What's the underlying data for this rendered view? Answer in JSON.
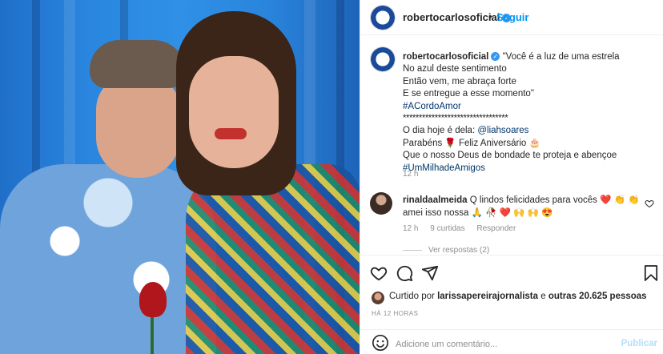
{
  "post": {
    "username": "robertocarlosoficial",
    "follow_label": "Seguir",
    "separator": "•"
  },
  "caption": {
    "username": "robertocarlosoficial",
    "lines": [
      "\"Você é a luz de uma estrela",
      "No azul deste sentimento",
      "Então vem, me abraça forte",
      "E se entregue a esse momento\""
    ],
    "hashtag1": "#ACordoAmor",
    "divider": "*********************************",
    "day_prefix": "O dia hoje é dela: ",
    "mention": "@liahsoares",
    "birthday": "Parabéns 🌹 Feliz Aniversário 🎂",
    "blessing": "Que o nosso Deus de bondade te proteja e abençoe",
    "hashtag2": "#UmMilhadeAmigos",
    "time": "12 h"
  },
  "comment": {
    "username": "rinaldaalmeida",
    "text": "Q lindos felicidades para vocês ❤️ 👏 👏 amei isso nossa 🙏 🥀 ❤️ 🙌 🙌 😍",
    "time": "12 h",
    "likes": "9 curtidas",
    "reply_label": "Responder",
    "view_replies": "Ver respostas (2)"
  },
  "likes": {
    "prefix": "Curtido por ",
    "user": "larissapereirajornalista",
    "middle": " e ",
    "others": "outras 20.625 pessoas"
  },
  "date": "HÁ 12 HORAS",
  "add_comment": {
    "placeholder": "Adicione um comentário...",
    "post_label": "Publicar"
  }
}
